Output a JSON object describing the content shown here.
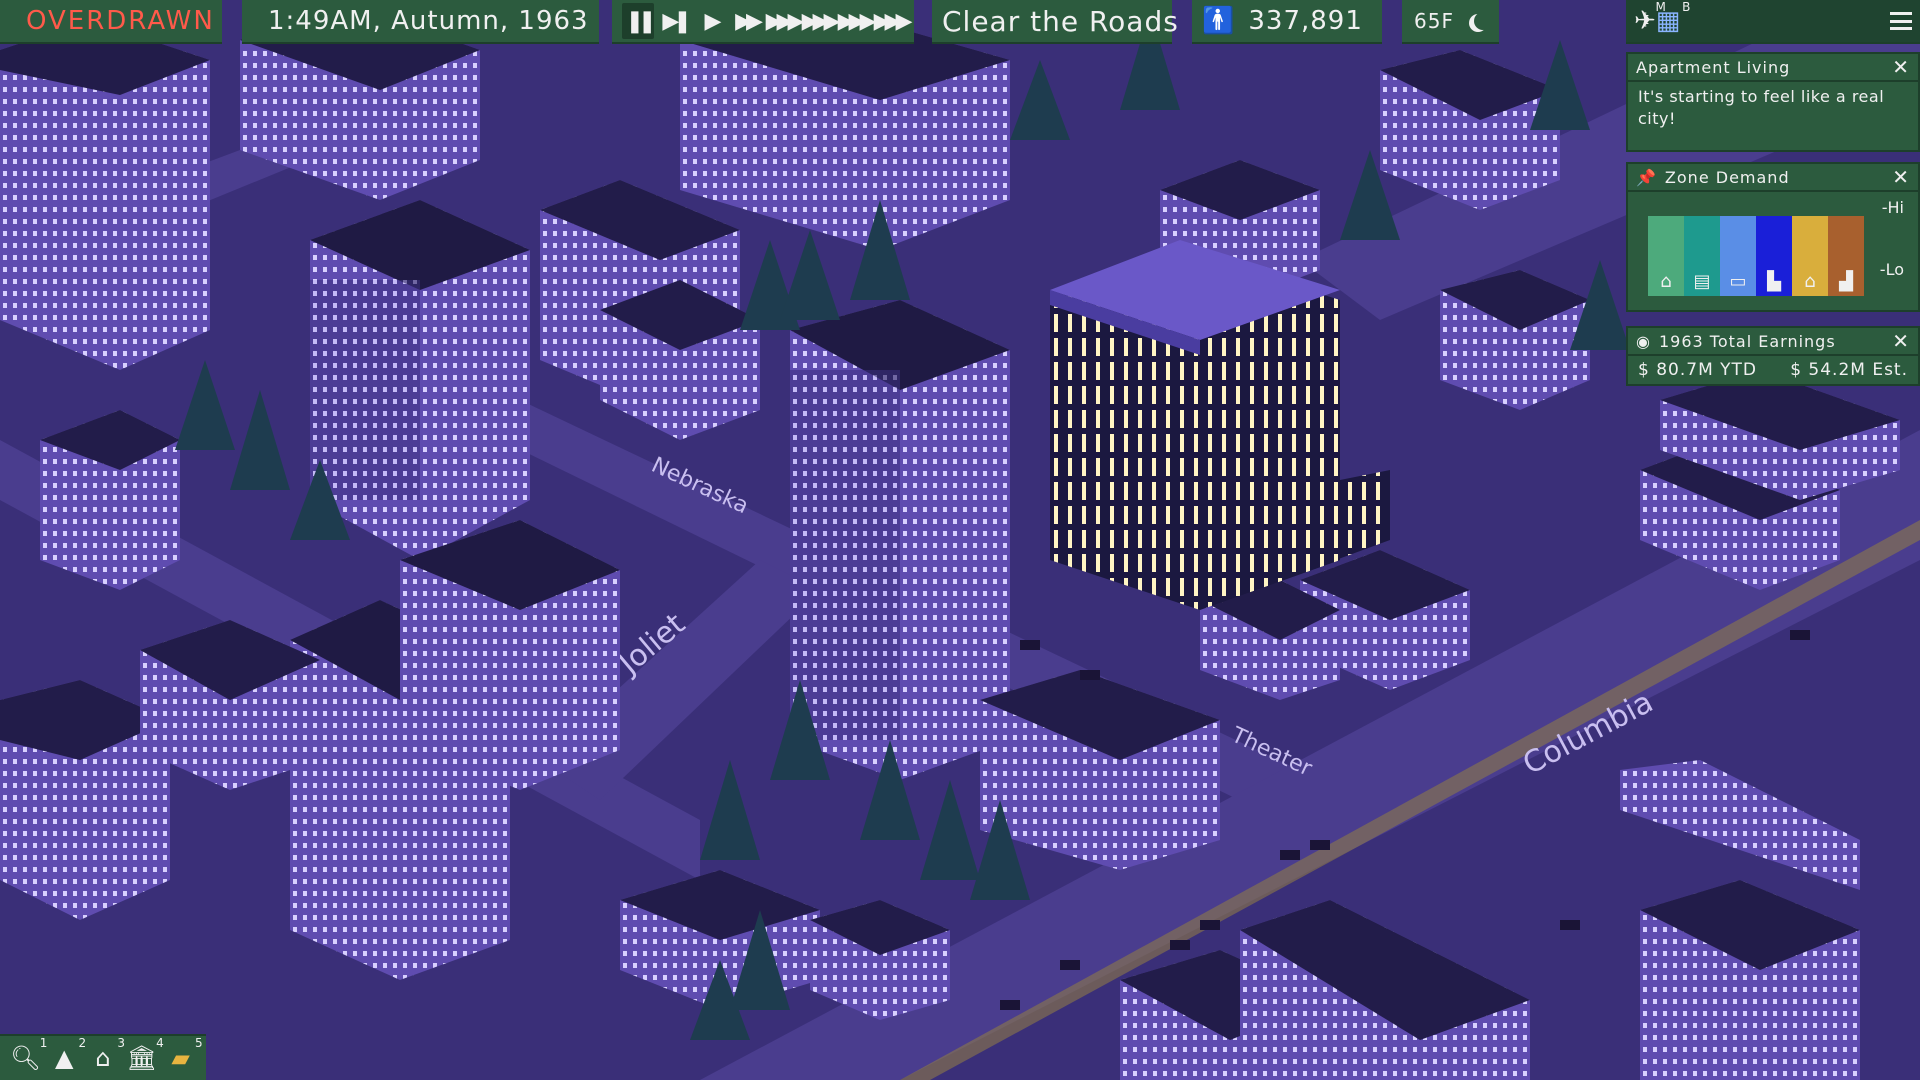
{
  "hud": {
    "status": "OVERDRAWN",
    "datetime": "1:49AM, Autumn, 1963",
    "goal": "Clear the Roads",
    "population": "337,891",
    "temperature": "65F",
    "speed_buttons": [
      "pause",
      "play-step",
      "play",
      "fast-2",
      "fast-3",
      "fast-4",
      "fast-5",
      "fast-6"
    ],
    "active_speed": "pause"
  },
  "tools": {
    "map_toggle_label": "M",
    "grid_toggle_label": "B"
  },
  "message_panel": {
    "title": "Apartment Living",
    "body": "It's starting to feel like a real city!"
  },
  "zone_demand": {
    "title": "Zone Demand",
    "hi_label": "-Hi",
    "lo_label": "-Lo",
    "zones": [
      {
        "name": "residential-low",
        "color": "#4daa7c",
        "icon": "house-icon"
      },
      {
        "name": "residential-high",
        "color": "#1e9a8e",
        "icon": "apartment-icon"
      },
      {
        "name": "commercial-low",
        "color": "#5a8ee6",
        "icon": "shop-icon"
      },
      {
        "name": "commercial-high",
        "color": "#1a1fd8",
        "icon": "office-icon"
      },
      {
        "name": "industrial-low",
        "color": "#d9ae3c",
        "icon": "farm-icon"
      },
      {
        "name": "industrial-high",
        "color": "#a8602e",
        "icon": "factory-icon"
      }
    ]
  },
  "earnings": {
    "title": "1963 Total Earnings",
    "ytd": "$ 80.7M YTD",
    "estimate": "$ 54.2M Est."
  },
  "bottom_tools": [
    {
      "name": "inspect-tool",
      "icon": "magnifier-icon",
      "key": "1"
    },
    {
      "name": "roads-tool",
      "icon": "road-icon",
      "key": "2"
    },
    {
      "name": "zoning-tool",
      "icon": "house-icon",
      "key": "3"
    },
    {
      "name": "services-tool",
      "icon": "building-icon",
      "key": "4"
    },
    {
      "name": "budget-tool",
      "icon": "money-icon",
      "key": "5"
    }
  ],
  "street_labels": [
    "Nebraska",
    "Joliet",
    "Theater",
    "Columbia"
  ],
  "colors": {
    "panel": "#2c5b3e",
    "panel_border": "#1d3f2b",
    "overdrawn": "#ff5a4a"
  }
}
